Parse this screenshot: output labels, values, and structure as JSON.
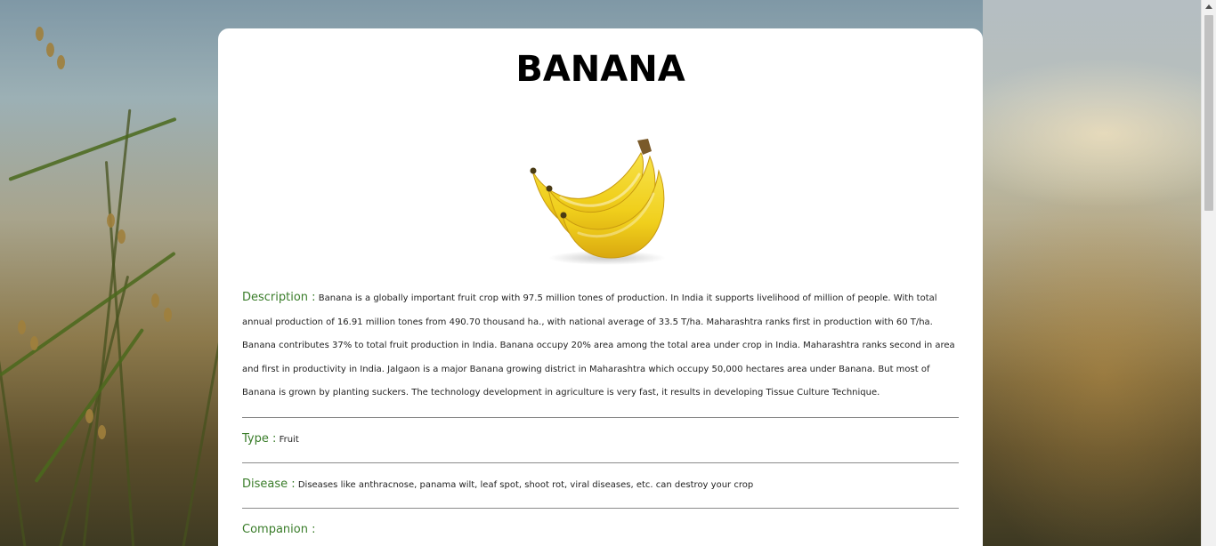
{
  "page": {
    "title": "BANANA"
  },
  "image": {
    "icon": "banana-image",
    "alt": "banana bunch"
  },
  "details": {
    "description_label": "Description :",
    "description_text": "Banana is a globally important fruit crop with 97.5 million tones of production. In India it supports livelihood of million of people. With total annual production of 16.91 million tones from 490.70 thousand ha., with national average of 33.5 T/ha. Maharashtra ranks first in production with 60 T/ha. Banana contributes 37% to total fruit production in India. Banana occupy 20% area among the total area under crop in India. Maharashtra ranks second in area and first in productivity in India. Jalgaon is a major Banana growing district in Maharashtra which occupy 50,000 hectares area under Banana. But most of Banana is grown by planting suckers. The technology development in agriculture is very fast, it results in developing Tissue Culture Technique.",
    "type_label": "Type :",
    "type_value": "Fruit",
    "disease_label": "Disease :",
    "disease_value": "Diseases like anthracnose, panama wilt, leaf spot, shoot rot, viral diseases, etc. can destroy your crop",
    "companion_label": "Companion :",
    "companion_value": ""
  },
  "colors": {
    "label_green": "#3a7d2a",
    "card_bg": "#ffffff",
    "divider": "#8a8a8a"
  }
}
